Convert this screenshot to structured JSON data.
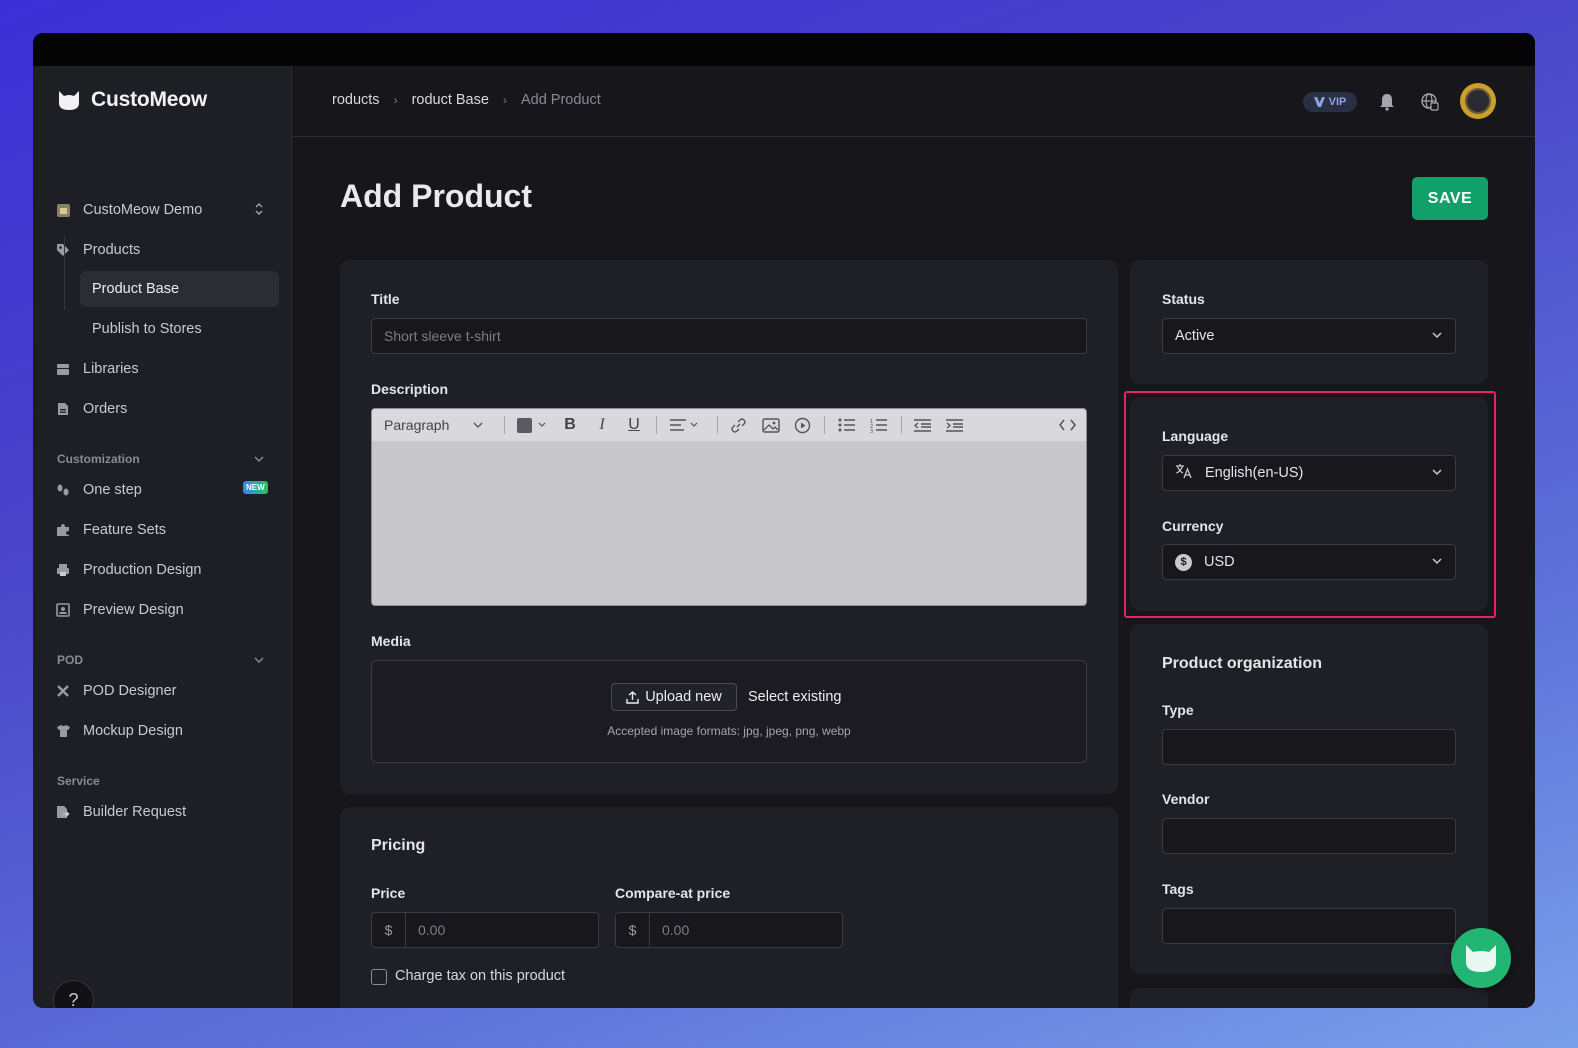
{
  "app": {
    "name": "CustoMeow"
  },
  "sidebar": {
    "workspace": "CustoMeow Demo",
    "items": [
      {
        "label": "Products",
        "icon": "tag-icon"
      },
      {
        "label": "Product Base",
        "icon": ""
      },
      {
        "label": "Publish to Stores",
        "icon": ""
      },
      {
        "label": "Libraries",
        "icon": "stack-icon"
      },
      {
        "label": "Orders",
        "icon": "document-icon"
      }
    ],
    "sections": [
      {
        "label": "Customization",
        "items": [
          "One step",
          "Feature Sets",
          "Production Design",
          "Preview Design"
        ]
      },
      {
        "label": "POD",
        "items": [
          "POD Designer",
          "Mockup Design"
        ]
      },
      {
        "label": "Service",
        "items": [
          "Builder Request"
        ]
      }
    ],
    "new_badge": "NEW",
    "help": "?"
  },
  "breadcrumb": [
    "roducts",
    "roduct Base",
    "Add Product"
  ],
  "header": {
    "vip_label": "VIP"
  },
  "page": {
    "title": "Add Product",
    "save_label": "SAVE"
  },
  "form": {
    "title_label": "Title",
    "title_placeholder": "Short sleeve t-shirt",
    "description_label": "Description",
    "editor_block_format": "Paragraph",
    "media_label": "Media",
    "upload_label": "Upload new",
    "select_existing_label": "Select existing",
    "formats_text": "Accepted image formats: jpg, jpeg, png, webp"
  },
  "pricing": {
    "heading": "Pricing",
    "price_label": "Price",
    "compare_label": "Compare-at price",
    "currency_prefix": "$",
    "price_placeholder": "0.00",
    "compare_placeholder": "0.00",
    "tax_label": "Charge tax on this product"
  },
  "status": {
    "label": "Status",
    "value": "Active"
  },
  "locale": {
    "language_label": "Language",
    "language_value": "English(en-US)",
    "currency_label": "Currency",
    "currency_value": "USD"
  },
  "organization": {
    "heading": "Product organization",
    "type_label": "Type",
    "vendor_label": "Vendor",
    "tags_label": "Tags"
  },
  "colors": {
    "accent": "#12a06a",
    "highlight": "#e7245e",
    "fab": "#22b573"
  }
}
